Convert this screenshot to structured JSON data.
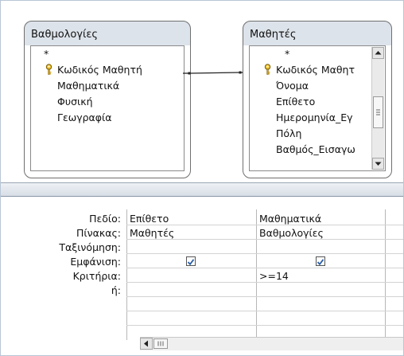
{
  "diagram": {
    "tables": [
      {
        "title": "Βαθμολογίες",
        "fields": [
          "*",
          "Κωδικός Μαθητή",
          "Μαθηματικά",
          "Φυσική",
          "Γεωγραφία"
        ],
        "key_field": "Κωδικός Μαθητή"
      },
      {
        "title": "Μαθητές",
        "fields": [
          "*",
          "Κωδικός Μαθητ",
          "Όνομα",
          "Επίθετο",
          "Ημερομηνία_Εγ",
          "Πόλη",
          "Βαθμός_Εισαγω"
        ],
        "key_field": "Κωδικός Μαθητ"
      }
    ],
    "relationship_line": "Κωδικός Μαθητή – Κωδικός Μαθητ"
  },
  "qbe": {
    "row_labels": {
      "field": "Πεδίο:",
      "table": "Πίνακας:",
      "sort": "Ταξινόμηση:",
      "show": "Εμφάνιση:",
      "criteria": "Κριτήρια:",
      "or": "ή:"
    },
    "columns": [
      {
        "field": "Επίθετο",
        "table": "Μαθητές",
        "sort": "",
        "show": true,
        "criteria": ""
      },
      {
        "field": "Μαθηματικά",
        "table": "Βαθμολογίες",
        "sort": "",
        "show": true,
        "criteria": ">=14"
      }
    ]
  },
  "icons": {
    "key": "key-icon",
    "scroll_up": "scroll-up-arrow-icon",
    "scroll_down": "scroll-down-arrow-icon",
    "scroll_left": "scroll-left-arrow-icon",
    "check": "checkmark-icon"
  },
  "colors": {
    "table_header": "#dde3ea",
    "splitter": "#d8dee6",
    "check": "#2a5fa8"
  }
}
